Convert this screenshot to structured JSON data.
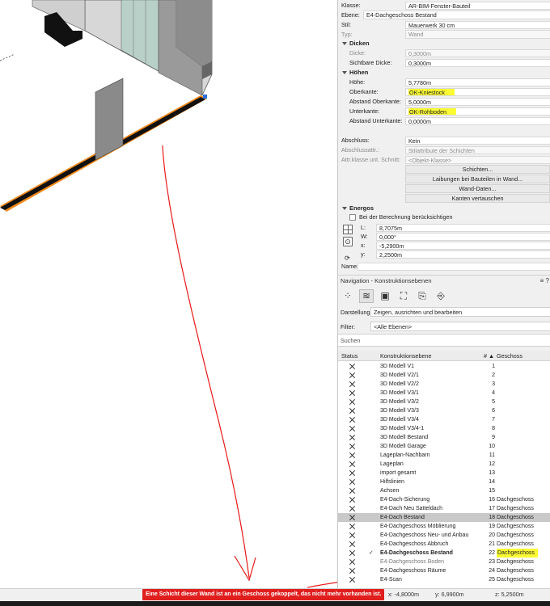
{
  "props": {
    "klasse_label": "Klasse:",
    "klasse_value": "AR-BIM-Fenster-Bauteil",
    "ebene_label": "Ebene:",
    "ebene_value": "E4-Dachgeschoss Bestand",
    "stil_label": "Stil:",
    "stil_value": "Mauerwerk 30 cm",
    "typ_label": "Typ:",
    "typ_value": "Wand",
    "dicken_title": "Dicken",
    "dicke_label": "Dicke:",
    "dicke_value": "0,3000m",
    "sicht_label": "Sichtbare Dicke:",
    "sicht_value": "0,3000m",
    "hoehen_title": "Höhen",
    "hoehe_label": "Höhe:",
    "hoehe_value": "5,7780m",
    "oberkante_label": "Oberkante:",
    "oberkante_value": "OK-Kniestock",
    "abst_ober_label": "Abstand Oberkante:",
    "abst_ober_value": "5,0000m",
    "unterkante_label": "Unterkante:",
    "unterkante_value": "OK-Rohboden",
    "abst_unter_label": "Abstand Unterkante:",
    "abst_unter_value": "0,0000m",
    "abschluss_label": "Abschluss:",
    "abschluss_value": "Kein",
    "abschlussattr_label": "Abschlussattr.:",
    "abschlussattr_value": "Stilattribute der Schichten",
    "attrklasse_label": "Attr.klasse unt. Schnitt:",
    "attrklasse_value": "<Objekt-Klasse>",
    "btn_schichten": "Schichten...",
    "btn_laibungen": "Laibungen bei Bauteilen in Wand...",
    "btn_wanddaten": "Wand-Daten...",
    "btn_kanten": "Kanten vertauschen",
    "energos_title": "Energos",
    "energos_check": "Bei der Berechnung berücksichtigen",
    "l_label": "L:",
    "l_value": "8,7075m",
    "w_label": "W:",
    "w_value": "0,000°",
    "x_label": "x:",
    "x_value": "-5,2900m",
    "y_label": "y:",
    "y_value": "2,2500m",
    "name_label": "Name:"
  },
  "nav": {
    "title": "Navigation - Konstruktionsebenen",
    "menu_icon": "≡ ?",
    "darstellung_label": "Darstellung:",
    "darstellung_value": "Zeigen, ausrichten und bearbeiten",
    "filter_label": "Filter:",
    "filter_value": "<Alle Ebenen>",
    "search_placeholder": "Suchen",
    "col_status": "Status",
    "col_ebene": "Konstruktionsebene",
    "col_sort": "# ▲",
    "col_geschoss": "Geschoss",
    "rows": [
      {
        "name": "3D Modell V1",
        "num": "1",
        "ges": ""
      },
      {
        "name": "3D Modell V2/1",
        "num": "2",
        "ges": ""
      },
      {
        "name": "3D Modell V2/2",
        "num": "3",
        "ges": ""
      },
      {
        "name": "3D Modell V3/1",
        "num": "4",
        "ges": ""
      },
      {
        "name": "3D Modell V3/2",
        "num": "5",
        "ges": ""
      },
      {
        "name": "3D Modell V3/3",
        "num": "6",
        "ges": ""
      },
      {
        "name": "3D Modell V3/4",
        "num": "7",
        "ges": ""
      },
      {
        "name": "3D Modell V3/4-1",
        "num": "8",
        "ges": ""
      },
      {
        "name": "3D Modell Bestand",
        "num": "9",
        "ges": ""
      },
      {
        "name": "3D Modell Garage",
        "num": "10",
        "ges": ""
      },
      {
        "name": "Lageplan-Nachbarn",
        "num": "11",
        "ges": ""
      },
      {
        "name": "Lageplan",
        "num": "12",
        "ges": ""
      },
      {
        "name": "import gesamt",
        "num": "13",
        "ges": ""
      },
      {
        "name": "Hilfslinien",
        "num": "14",
        "ges": ""
      },
      {
        "name": "Achsen",
        "num": "15",
        "ges": ""
      },
      {
        "name": "E4-Dach-Sicherung",
        "num": "16",
        "ges": "Dachgeschoss"
      },
      {
        "name": "E4-Dach Neu Satteldach",
        "num": "17",
        "ges": "Dachgeschoss"
      },
      {
        "name": "E4-Dach Bestand",
        "num": "18",
        "ges": "Dachgeschoss"
      },
      {
        "name": "E4-Dachgeschoss Möblierung",
        "num": "19",
        "ges": "Dachgeschoss"
      },
      {
        "name": "E4-Dachgeschoss Neu- und Anbau",
        "num": "20",
        "ges": "Dachgeschoss"
      },
      {
        "name": "E4-Dachgeschoss Abbruch",
        "num": "21",
        "ges": "Dachgeschoss"
      },
      {
        "name": "E4-Dachgeschoss Bestand",
        "num": "22",
        "ges": "Dachgeschoss"
      },
      {
        "name": "E4-Dachgeschoss Boden",
        "num": "23",
        "ges": "Dachgeschoss"
      },
      {
        "name": "E4-Dachgeschoss Räume",
        "num": "24",
        "ges": "Dachgeschoss"
      },
      {
        "name": "E4-Scan",
        "num": "25",
        "ges": "Dachgeschoss"
      }
    ]
  },
  "status": {
    "error": "Eine Schicht dieser Wand ist an ein Geschoss gekoppelt, das nicht mehr vorhanden ist.",
    "x": "x: -4,8000m",
    "y": "y: 6,9900m",
    "z": "z: 5,2500m"
  },
  "colors": {
    "highlight": "#fbfb34",
    "error": "#e01e1e",
    "annotation": "#e81818",
    "wall_edge": "#f28a1c"
  }
}
